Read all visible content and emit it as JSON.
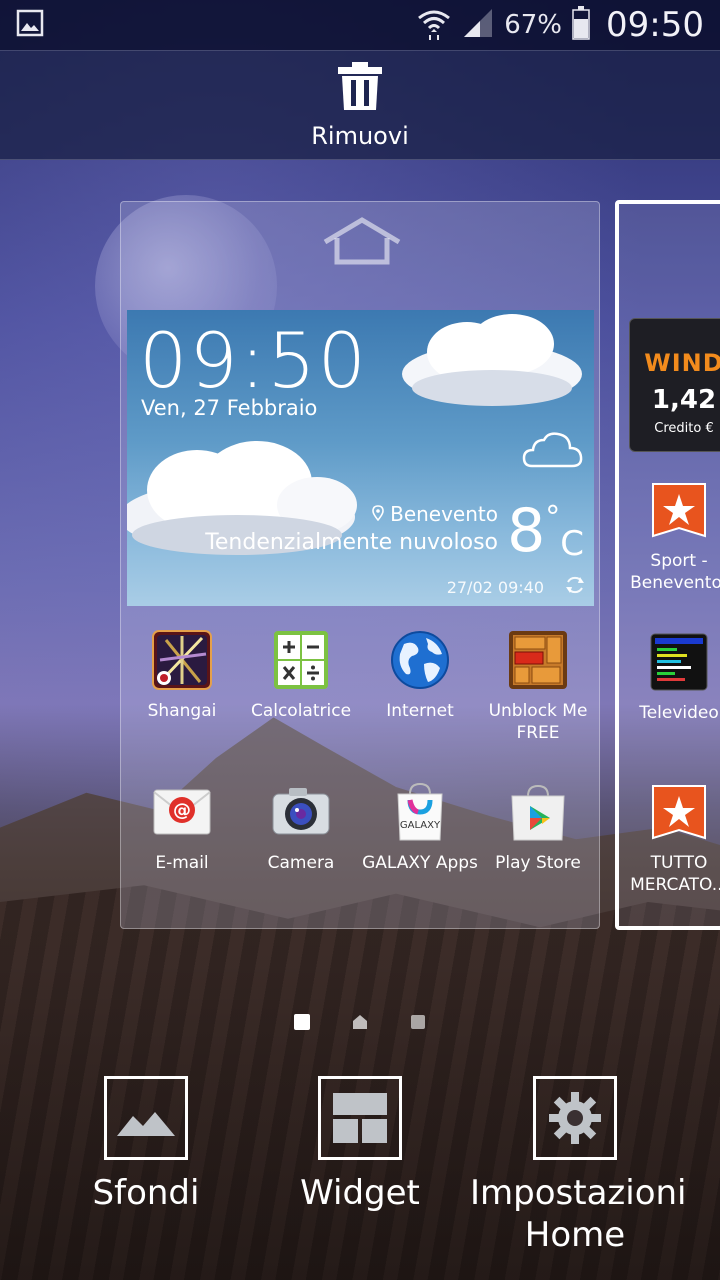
{
  "status_bar": {
    "battery_percent": "67%",
    "time": "09:50"
  },
  "remove_bar": {
    "label": "Rimuovi"
  },
  "weather_widget": {
    "time": "09:50",
    "date": "Ven, 27 Febbraio",
    "city": "Benevento",
    "condition": "Tendenzialmente nuvoloso",
    "temperature": "8",
    "degree_symbol": "°",
    "unit": "C",
    "updated": "27/02 09:40"
  },
  "apps": [
    {
      "label": "Shangai"
    },
    {
      "label": "Calcolatrice"
    },
    {
      "label": "Internet"
    },
    {
      "label": "Unblock Me FREE"
    },
    {
      "label": "E-mail"
    },
    {
      "label": "Camera"
    },
    {
      "label": "GALAXY Apps"
    },
    {
      "label": "Play Store"
    }
  ],
  "side_page": {
    "wind_logo": "WIND",
    "wind_value": "1,42",
    "wind_sub": "Credito €",
    "apps": [
      {
        "label": "Sport - Beneventof"
      },
      {
        "label": "Televideo"
      },
      {
        "label": "TUTTO MERCATO..."
      }
    ]
  },
  "bottom_actions": {
    "wallpapers": "Sfondi",
    "widgets": "Widget",
    "home_settings": "Impostazioni Home"
  },
  "colors": {
    "wind_orange": "#f28b1d",
    "weather_sky": "#5f9bc8"
  }
}
